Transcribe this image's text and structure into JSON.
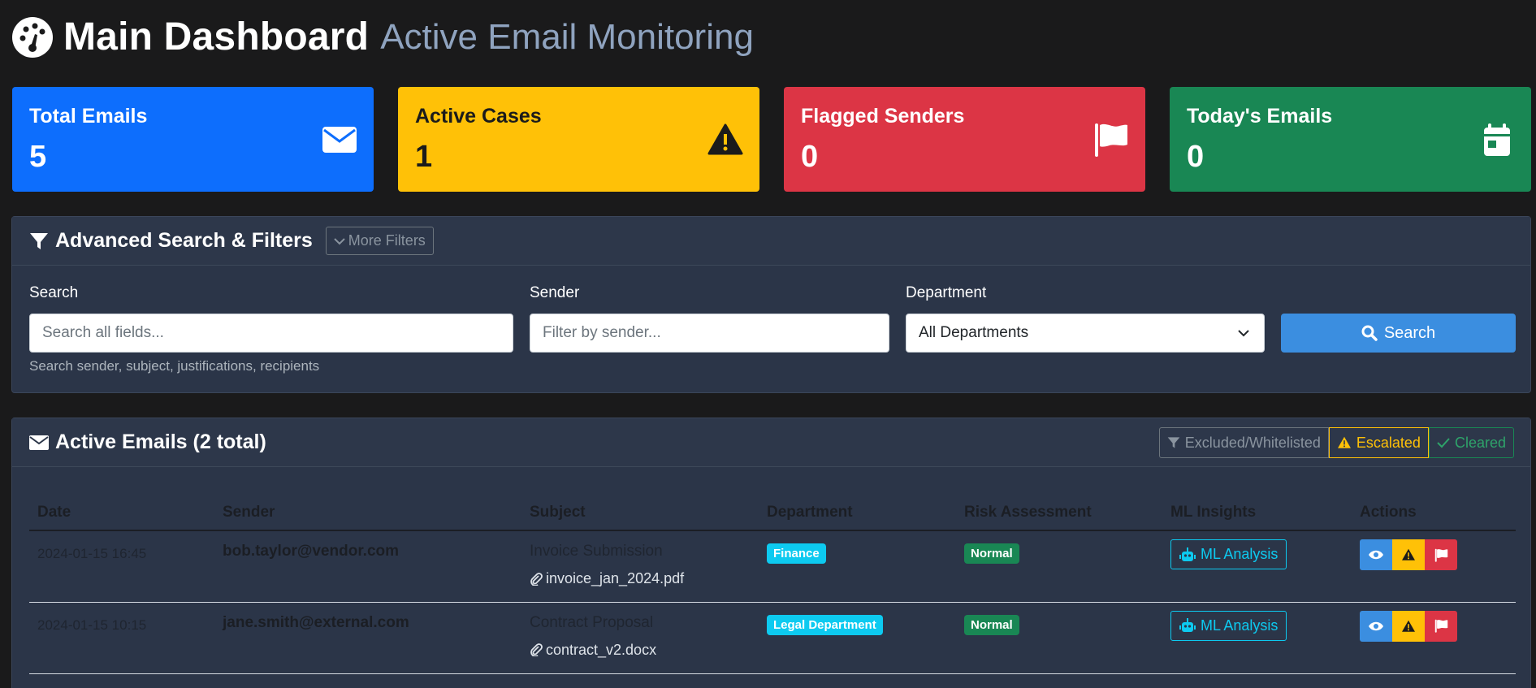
{
  "header": {
    "title": "Main Dashboard",
    "subtitle": "Active Email Monitoring"
  },
  "stats": [
    {
      "label": "Total Emails",
      "value": "5",
      "icon": "envelope-icon",
      "color": "#0d6efd"
    },
    {
      "label": "Active Cases",
      "value": "1",
      "icon": "warning-icon",
      "color": "#ffc107"
    },
    {
      "label": "Flagged Senders",
      "value": "0",
      "icon": "flag-icon",
      "color": "#dc3545"
    },
    {
      "label": "Today's Emails",
      "value": "0",
      "icon": "calendar-icon",
      "color": "#198754"
    }
  ],
  "filters": {
    "title": "Advanced Search & Filters",
    "more_filters_label": "More Filters",
    "search_label": "Search",
    "search_placeholder": "Search all fields...",
    "search_help": "Search sender, subject, justifications, recipients",
    "sender_label": "Sender",
    "sender_placeholder": "Filter by sender...",
    "department_label": "Department",
    "department_value": "All Departments",
    "search_button": "Search"
  },
  "emails": {
    "title": "Active Emails (2 total)",
    "toggles": {
      "excluded": "Excluded/Whitelisted",
      "escalated": "Escalated",
      "cleared": "Cleared"
    },
    "columns": [
      "Date",
      "Sender",
      "Subject",
      "Department",
      "Risk Assessment",
      "ML Insights",
      "Actions"
    ],
    "rows": [
      {
        "date": "2024-01-15 16:45",
        "sender": "bob.taylor@vendor.com",
        "subject": "Invoice Submission",
        "attachment": "invoice_jan_2024.pdf",
        "department": "Finance",
        "risk": "Normal",
        "ml_label": "ML Analysis"
      },
      {
        "date": "2024-01-15 10:15",
        "sender": "jane.smith@external.com",
        "subject": "Contract Proposal",
        "attachment": "contract_v2.docx",
        "department": "Legal Department",
        "risk": "Normal",
        "ml_label": "ML Analysis"
      }
    ]
  }
}
